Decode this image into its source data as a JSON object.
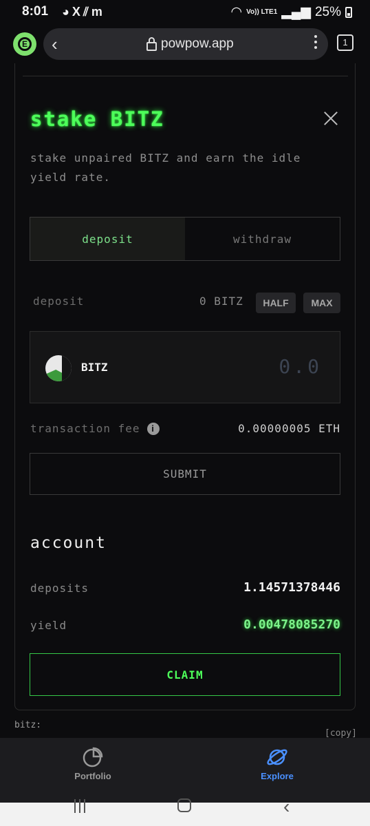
{
  "status": {
    "time": "8:01",
    "left_icons": [
      "discord-icon",
      "x-icon",
      "pixel-icon",
      "m-icon"
    ],
    "battery": "25%",
    "network": "Vo)) LTE1"
  },
  "browser": {
    "url": "powpow.app",
    "tab_count": "1"
  },
  "stake": {
    "title": "stake BITZ",
    "description": "stake unpaired BITZ and earn the idle yield rate.",
    "tabs": {
      "deposit": "deposit",
      "withdraw": "withdraw"
    },
    "deposit_label": "deposit",
    "balance": "0 BITZ",
    "half_label": "HALF",
    "max_label": "MAX",
    "token": "BITZ",
    "amount_placeholder": "0.0",
    "fee_label": "transaction fee",
    "fee_value": "0.00000005 ETH",
    "submit_label": "SUBMIT"
  },
  "account": {
    "title": "account",
    "deposits_label": "deposits",
    "deposits_value": "1.14571378446",
    "yield_label": "yield",
    "yield_value": "0.00478085270",
    "claim_label": "CLAIM"
  },
  "footer": {
    "bitz_label": "bitz:",
    "copy_label": "[copy]"
  },
  "nav": {
    "portfolio": "Portfolio",
    "explore": "Explore"
  },
  "colors": {
    "accent_green": "#4dff5a",
    "explore_blue": "#4a90ff",
    "background": "#0c0c0e"
  }
}
